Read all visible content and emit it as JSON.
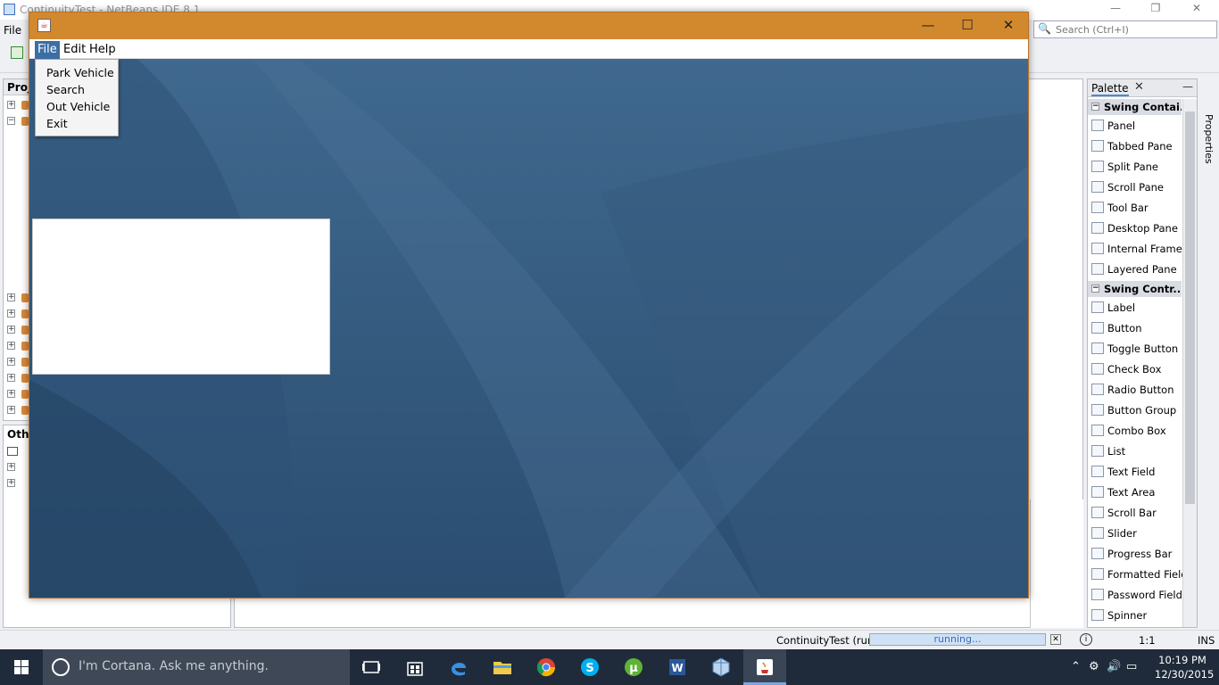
{
  "ide": {
    "title": "ContinuityTest - NetBeans IDE 8.1",
    "menu_file": "File",
    "search_placeholder": "Search (Ctrl+I)",
    "projects_tab": "Proj",
    "other_tab": "Othe",
    "palette": {
      "title": "Palette",
      "sections": [
        {
          "label": "Swing Contai...",
          "items": [
            "Panel",
            "Tabbed Pane",
            "Split Pane",
            "Scroll Pane",
            "Tool Bar",
            "Desktop Pane",
            "Internal Frame",
            "Layered Pane"
          ]
        },
        {
          "label": "Swing Contr...",
          "items": [
            "Label",
            "Button",
            "Toggle Button",
            "Check Box",
            "Radio Button",
            "Button Group",
            "Combo Box",
            "List",
            "Text Field",
            "Text Area",
            "Scroll Bar",
            "Slider",
            "Progress Bar",
            "Formatted Field",
            "Password Field",
            "Spinner"
          ]
        }
      ]
    },
    "properties_label": "Properties",
    "status": {
      "project": "ContinuityTest (run)",
      "progress_text": "running...",
      "progress_fraction": 1.0,
      "position": "1:1",
      "mode": "INS"
    }
  },
  "app": {
    "menus": [
      "File",
      "Edit",
      "Help"
    ],
    "file_menu_items": [
      "Park Vehicle",
      "Search",
      "Out Vehicle",
      "Exit"
    ],
    "title_accent": "#d2892d",
    "background_color": "#2e5479"
  },
  "taskbar": {
    "cortana_placeholder": "I'm Cortana. Ask me anything.",
    "apps": [
      "task-view",
      "store",
      "edge",
      "file-explorer",
      "chrome",
      "skype",
      "utorrent",
      "word",
      "virtualbox",
      "java"
    ],
    "time": "10:19 PM",
    "date": "12/30/2015"
  }
}
